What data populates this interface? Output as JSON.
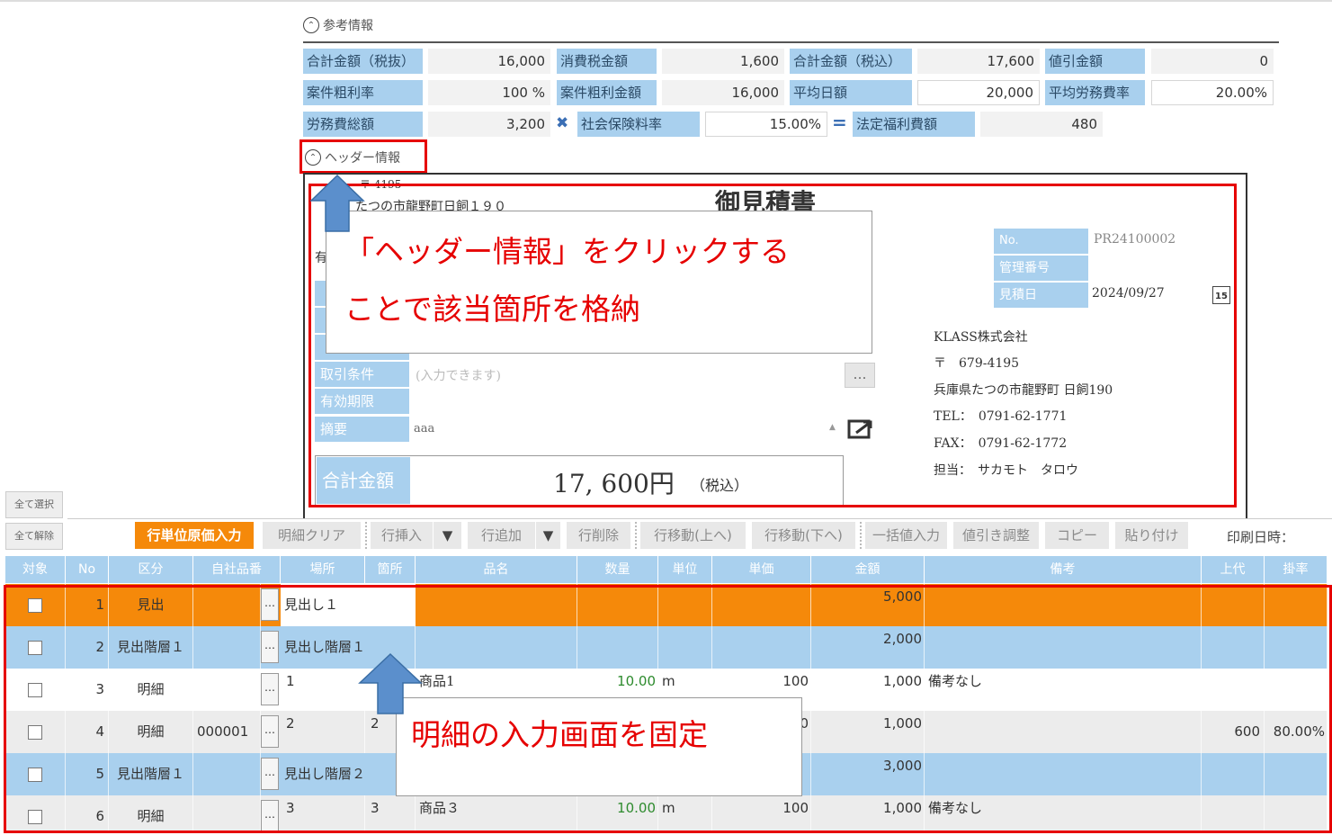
{
  "ref_section": {
    "toggle_label": "参考情報"
  },
  "summary": {
    "row1": [
      {
        "label": "合計金額（税抜）",
        "value": "16,000"
      },
      {
        "label": "消費税金額",
        "value": "1,600"
      },
      {
        "label": "合計金額（税込）",
        "value": "17,600"
      },
      {
        "label": "値引金額",
        "value": "0"
      }
    ],
    "row2": [
      {
        "label": "案件粗利率",
        "value": "100 %"
      },
      {
        "label": "案件粗利金額",
        "value": "16,000"
      },
      {
        "label": "平均日額",
        "value": "20,000"
      },
      {
        "label": "平均労務費率",
        "value": "20.00%"
      }
    ],
    "row3": {
      "labor_label": "労務費総額",
      "labor_value": "3,200",
      "times_sign": "✖",
      "insurance_label": "社会保険料率",
      "insurance_value": "15.00%",
      "equals_sign": "=",
      "welfare_label": "法定福利費額",
      "welfare_value": "480"
    }
  },
  "header_section": {
    "toggle_label": "ヘッダー情報"
  },
  "document": {
    "postal_fragment": "〒 4195",
    "address_fragment": "たつの市龍野町日飼１９０",
    "title": "御見積書",
    "left_fragment": "有",
    "no_label": "No.",
    "no_value": "PR24100002",
    "mgmt_label": "管理番号",
    "mgmt_value": "",
    "date_label": "見積日",
    "date_value": "2024/09/27",
    "calendar_day": "15",
    "terms_label": "取引条件",
    "terms_placeholder": "(入力できます)",
    "validity_label": "有効期限",
    "summary_label": "摘要",
    "summary_value": "aaa",
    "ellipsis": "…",
    "total_label": "合計金額",
    "total_value": "17, 600円",
    "tax_note": "（税込）",
    "company": {
      "name": "KLASS株式会社",
      "postal": "〒　679-4195",
      "address": "兵庫県たつの市龍野町 日飼190",
      "tel": "TEL：　0791-62-1771",
      "fax": "FAX：　0791-62-1772",
      "person": "担当：　サカモト　タロウ"
    }
  },
  "callouts": {
    "header_line1": "「ヘッダー情報」をクリックする",
    "header_line2": "ことで該当箇所を格納",
    "detail": "明細の入力画面を固定"
  },
  "side_buttons": {
    "select_all": "全て選択",
    "deselect_all": "全て解除"
  },
  "toolbar": {
    "cost_input": "行単位原価入力",
    "clear": "明細クリア",
    "insert": "行挿入",
    "add": "行追加",
    "delete": "行削除",
    "move_up": "行移動(上へ)",
    "move_down": "行移動(下へ)",
    "bulk": "一括値入力",
    "discount": "値引き調整",
    "copy": "コピー",
    "paste": "貼り付け",
    "print_date": "印刷日時："
  },
  "table": {
    "columns": [
      "対象",
      "No",
      "区分",
      "自社品番",
      "場所",
      "箇所",
      "品名",
      "数量",
      "単位",
      "単価",
      "金額",
      "備考",
      "上代",
      "掛率"
    ],
    "rows": [
      {
        "no": "1",
        "kubun": "見出",
        "code": "",
        "place": "見出し１",
        "spot": "",
        "name": "",
        "qty": "",
        "unit": "",
        "price": "",
        "amount": "5,000",
        "note": "",
        "retail": "",
        "rate": ""
      },
      {
        "no": "2",
        "kubun": "見出階層１",
        "code": "",
        "place": "見出し階層１",
        "spot": "",
        "name": "",
        "qty": "",
        "unit": "",
        "price": "",
        "amount": "2,000",
        "note": "",
        "retail": "",
        "rate": ""
      },
      {
        "no": "3",
        "kubun": "明細",
        "code": "",
        "place": "1",
        "spot": "",
        "name": "商品1",
        "qty": "10.00",
        "unit": "m",
        "price": "100",
        "amount": "1,000",
        "note": "備考なし",
        "retail": "",
        "rate": ""
      },
      {
        "no": "4",
        "kubun": "明細",
        "code": "000001",
        "place": "2",
        "spot": "2",
        "name": "",
        "qty": "",
        "unit": "",
        "price": "0",
        "amount": "1,000",
        "note": "",
        "retail": "600",
        "rate": "80.00%"
      },
      {
        "no": "5",
        "kubun": "見出階層１",
        "code": "",
        "place": "見出し階層２",
        "spot": "",
        "name": "",
        "qty": "",
        "unit": "",
        "price": "",
        "amount": "3,000",
        "note": "",
        "retail": "",
        "rate": ""
      },
      {
        "no": "6",
        "kubun": "明細",
        "code": "",
        "place": "3",
        "spot": "3",
        "name": "商品３",
        "qty": "10.00",
        "unit": "m",
        "price": "100",
        "amount": "1,000",
        "note": "備考なし",
        "retail": "",
        "rate": ""
      }
    ]
  },
  "colors": {
    "accent_orange": "#f5890a",
    "label_blue": "#a9d0ee",
    "highlight_red": "#e60000",
    "arrow_blue": "#5b8fcc"
  }
}
